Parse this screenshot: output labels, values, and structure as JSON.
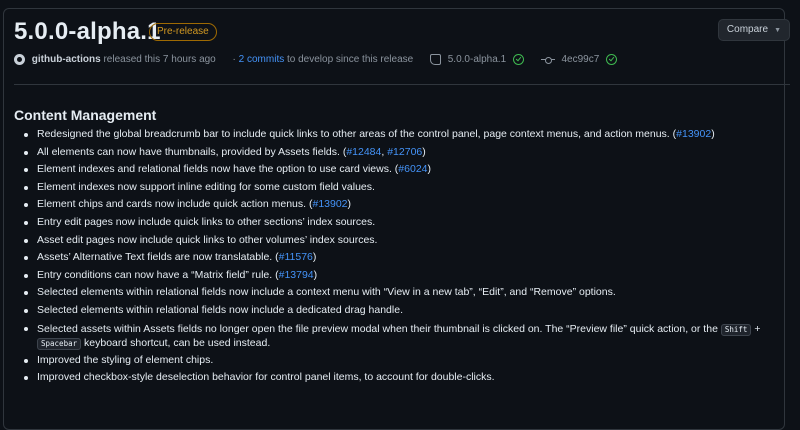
{
  "release": {
    "title": "5.0.0-alpha.1",
    "badge": "Pre-release",
    "compare_label": "Compare",
    "author": "github-actions",
    "released_text": "released this 7 hours ago",
    "commits_link": "2 commits",
    "commits_suffix": "to develop since this release",
    "tag": "5.0.0-alpha.1",
    "commit_sha": "4ec99c7"
  },
  "section": {
    "title": "Content Management"
  },
  "items": [
    {
      "text": "Redesigned the global breadcrumb bar to include quick links to other areas of the control panel, page context menus, and action menus. (",
      "refs": [
        "#13902"
      ],
      "tail": ")"
    },
    {
      "text": "All elements can now have thumbnails, provided by Assets fields. (",
      "refs": [
        "#12484",
        "#12706"
      ],
      "tail": ")"
    },
    {
      "text": "Element indexes and relational fields now have the option to use card views. (",
      "refs": [
        "#6024"
      ],
      "tail": ")"
    },
    {
      "text": "Element indexes now support inline editing for some custom field values."
    },
    {
      "text": "Element chips and cards now include quick action menus. (",
      "refs": [
        "#13902"
      ],
      "tail": ")"
    },
    {
      "text": "Entry edit pages now include quick links to other sections’ index sources."
    },
    {
      "text": "Asset edit pages now include quick links to other volumes’ index sources."
    },
    {
      "text": "Assets’ Alternative Text fields are now translatable. (",
      "refs": [
        "#11576"
      ],
      "tail": ")"
    },
    {
      "text": "Entry conditions can now have a “Matrix field” rule. (",
      "refs": [
        "#13794"
      ],
      "tail": ")"
    },
    {
      "text": "Selected elements within relational fields now include a context menu with “View in a new tab”, “Edit”, and “Remove” options."
    },
    {
      "text": "Selected elements within relational fields now include a dedicated drag handle."
    },
    {
      "text": "Selected assets within Assets fields no longer open the file preview modal when their thumbnail is clicked on. The “Preview file” quick action, or the ",
      "kbd": [
        "Shift",
        "Spacebar"
      ],
      "joiner": " + ",
      "tail": " keyboard shortcut, can be used instead."
    },
    {
      "text": "Improved the styling of element chips."
    },
    {
      "text": "Improved checkbox-style deselection behavior for control panel items, to account for double-clicks."
    }
  ],
  "colors": {
    "accent": "#4493f8",
    "badge": "#d29922",
    "success": "#3fb950",
    "background": "#0d1117"
  },
  "icons": [
    "github-icon",
    "tag-icon",
    "check-circle-icon",
    "commit-icon",
    "chevron-down-icon"
  ]
}
